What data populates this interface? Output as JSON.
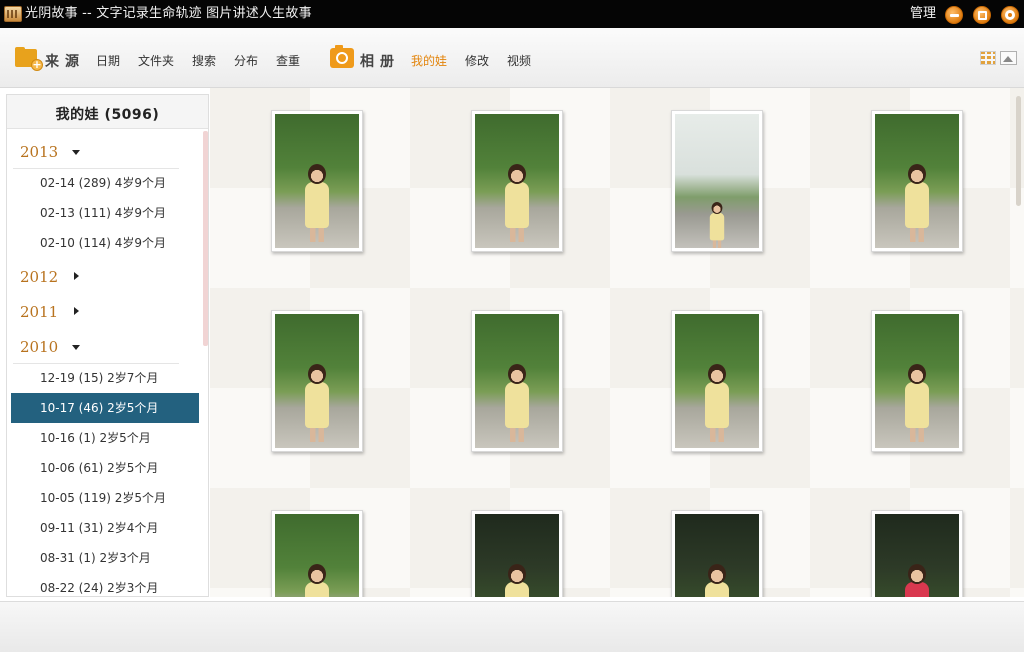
{
  "window": {
    "title": "光阴故事 -- 文字记录生命轨迹 图片讲述人生故事",
    "manage_label": "管理"
  },
  "toolbar": {
    "source_label": "来源",
    "source_links": [
      "日期",
      "文件夹",
      "搜索",
      "分布",
      "查重"
    ],
    "album_label": "相册",
    "album_links": [
      "我的娃",
      "修改",
      "视频"
    ],
    "active_album_link": "我的娃",
    "accent_color": "#e3850d"
  },
  "sidebar": {
    "album_title": "我的娃 (5096)",
    "years": [
      {
        "year": "2013",
        "expanded": true,
        "dates": [
          "02-14 (289) 4岁9个月",
          "02-13 (111) 4岁9个月",
          "02-10 (114) 4岁9个月"
        ]
      },
      {
        "year": "2012",
        "expanded": false,
        "dates": []
      },
      {
        "year": "2011",
        "expanded": false,
        "dates": []
      },
      {
        "year": "2010",
        "expanded": true,
        "dates": [
          "12-19 (15) 2岁7个月",
          "10-17 (46) 2岁5个月",
          "10-16 (1) 2岁5个月",
          "10-06 (61) 2岁5个月",
          "10-05 (119) 2岁5个月",
          "09-11 (31) 2岁4个月",
          "08-31 (1) 2岁3个月",
          "08-22 (24) 2岁3个月"
        ]
      }
    ],
    "selected_date": "10-17 (46) 2岁5个月",
    "selected_color": "#23617f",
    "year_color": "#b8731f"
  },
  "photos": [
    {
      "kind": "garden"
    },
    {
      "kind": "garden"
    },
    {
      "kind": "bright"
    },
    {
      "kind": "garden"
    },
    {
      "kind": "garden"
    },
    {
      "kind": "garden"
    },
    {
      "kind": "garden"
    },
    {
      "kind": "garden"
    },
    {
      "kind": "garden"
    },
    {
      "kind": "dark"
    },
    {
      "kind": "dark"
    },
    {
      "kind": "dark-red"
    }
  ],
  "icons": {
    "app": "film-strip-icon",
    "minimize": "minimize-icon",
    "maximize": "maximize-icon",
    "close": "close-icon",
    "source": "folder-add-icon",
    "album": "camera-icon",
    "grid_view": "grid-view-icon",
    "single_view": "single-image-view-icon"
  }
}
